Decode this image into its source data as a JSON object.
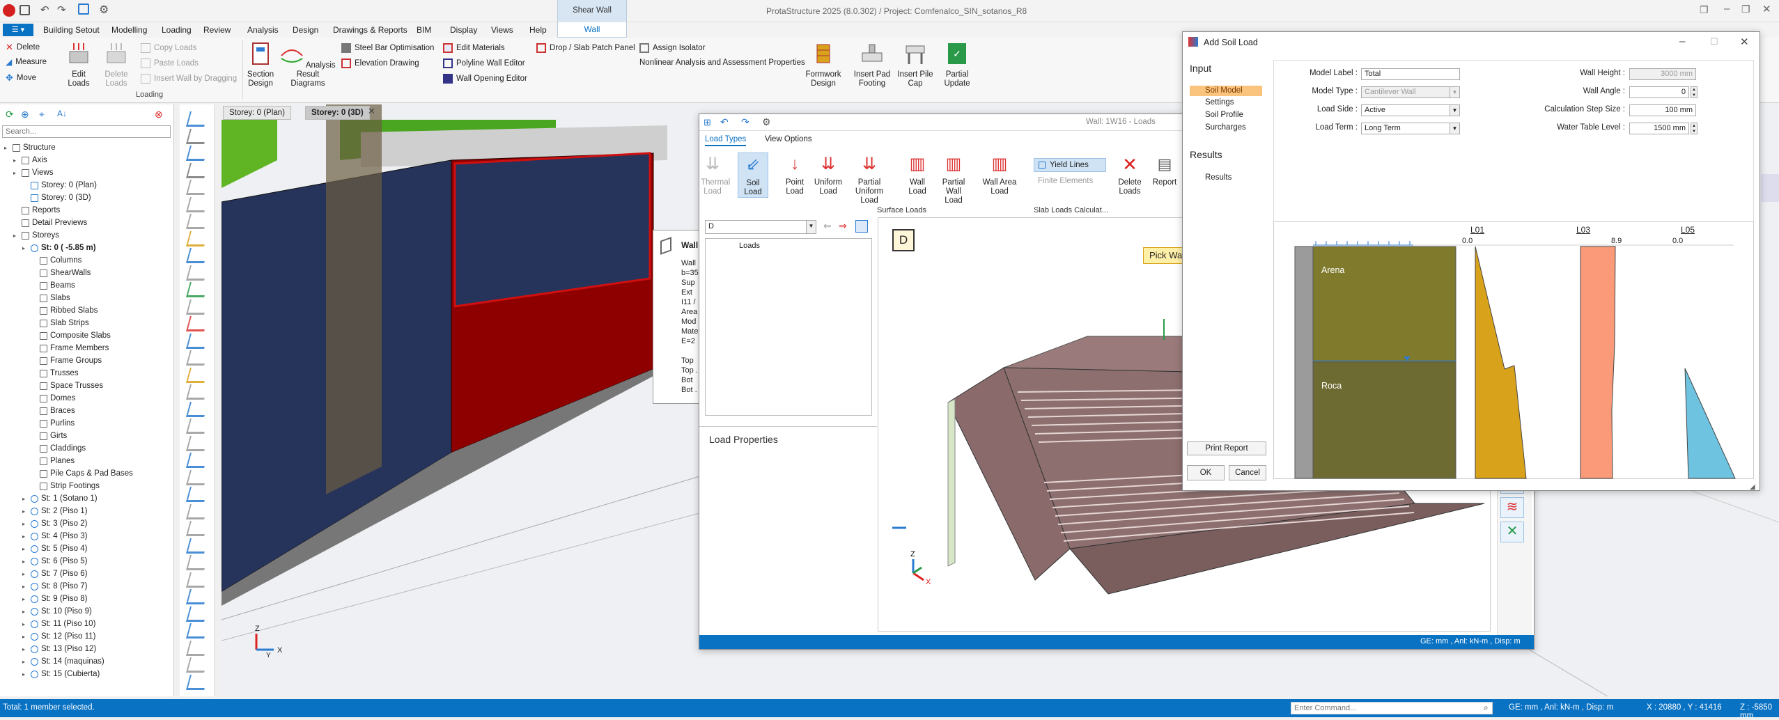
{
  "window": {
    "title": "ProtaStructure 2025 (8.0.302) / Project: Comfenalco_SIN_sotanos_R8",
    "context_tab_group": "Shear Wall Options",
    "context_tab": "Wall"
  },
  "menu": [
    "Building Setout",
    "Modelling",
    "Loading",
    "Review",
    "Analysis",
    "Design",
    "Drawings & Reports",
    "BIM",
    "Display",
    "Views",
    "Help"
  ],
  "ribbon": {
    "edit": {
      "delete": "Delete",
      "measure": "Measure",
      "move": "Move"
    },
    "edit_loads": "Edit Loads",
    "delete_loads": "Delete Loads",
    "copy_loads": "Copy Loads",
    "paste_loads": "Paste Loads",
    "insert_wall_by_dragging": "Insert Wall by Dragging",
    "group_label": "Loading",
    "section_design": "Section Design",
    "analysis_result_diagrams": "Analysis Result Diagrams",
    "steel_bar_optimisation": "Steel Bar Optimisation",
    "elevation_drawing": "Elevation Drawing",
    "edit_materials": "Edit Materials",
    "polyline_wall_editor": "Polyline Wall Editor",
    "wall_opening_editor": "Wall Opening Editor",
    "drop_slab_patch_panel": "Drop / Slab Patch Panel",
    "assign_isolator": "Assign Isolator",
    "nonlinear": "Nonlinear Analysis and Assessment Properties",
    "formwork_design": "Formwork Design",
    "insert_pad_footing": "Insert Pad Footing",
    "insert_pile_cap": "Insert Pile Cap",
    "partial_update": "Partial Update"
  },
  "left_panel": {
    "search_placeholder": "Search...",
    "tree": [
      {
        "label": "Structure",
        "level": 0
      },
      {
        "label": "Axis",
        "level": 1
      },
      {
        "label": "Views",
        "level": 1
      },
      {
        "label": "Storey: 0 (Plan)",
        "level": 2
      },
      {
        "label": "Storey: 0 (3D)",
        "level": 2
      },
      {
        "label": "Reports",
        "level": 1
      },
      {
        "label": "Detail Previews",
        "level": 1
      },
      {
        "label": "Storeys",
        "level": 1
      },
      {
        "label": "St: 0 ( -5.85 m)",
        "level": 2,
        "bold": true
      },
      {
        "label": "Columns",
        "level": 3
      },
      {
        "label": "ShearWalls",
        "level": 3
      },
      {
        "label": "Beams",
        "level": 3
      },
      {
        "label": "Slabs",
        "level": 3
      },
      {
        "label": "Ribbed Slabs",
        "level": 3
      },
      {
        "label": "Slab Strips",
        "level": 3
      },
      {
        "label": "Composite Slabs",
        "level": 3
      },
      {
        "label": "Frame Members",
        "level": 3
      },
      {
        "label": "Frame Groups",
        "level": 3
      },
      {
        "label": "Trusses",
        "level": 3
      },
      {
        "label": "Space Trusses",
        "level": 3
      },
      {
        "label": "Domes",
        "level": 3
      },
      {
        "label": "Braces",
        "level": 3
      },
      {
        "label": "Purlins",
        "level": 3
      },
      {
        "label": "Girts",
        "level": 3
      },
      {
        "label": "Claddings",
        "level": 3
      },
      {
        "label": "Planes",
        "level": 3
      },
      {
        "label": "Pile Caps & Pad Bases",
        "level": 3
      },
      {
        "label": "Strip Footings",
        "level": 3
      },
      {
        "label": "St: 1 (Sotano 1)",
        "level": 2
      },
      {
        "label": "St: 2 (Piso 1)",
        "level": 2
      },
      {
        "label": "St: 3 (Piso 2)",
        "level": 2
      },
      {
        "label": "St: 4 (Piso 3)",
        "level": 2
      },
      {
        "label": "St: 5 (Piso 4)",
        "level": 2
      },
      {
        "label": "St: 6 (Piso 5)",
        "level": 2
      },
      {
        "label": "St: 7 (Piso 6)",
        "level": 2
      },
      {
        "label": "St: 8 (Piso 7)",
        "level": 2
      },
      {
        "label": "St: 9 (Piso 8)",
        "level": 2
      },
      {
        "label": "St: 10 (Piso 9)",
        "level": 2
      },
      {
        "label": "St: 11 (Piso 10)",
        "level": 2
      },
      {
        "label": "St: 12 (Piso 11)",
        "level": 2
      },
      {
        "label": "St: 13 (Piso 12)",
        "level": 2
      },
      {
        "label": "St: 14 (maquinas)",
        "level": 2
      },
      {
        "label": "St: 15 (Cubierta)",
        "level": 2
      }
    ]
  },
  "view_tabs": [
    "Storey: 0 (Plan)",
    "Storey: 0 (3D)"
  ],
  "wall_popup": {
    "title": "Wall",
    "lines": [
      "Wall",
      "b=35",
      "Sup",
      "Ext",
      "I11 /",
      "Area",
      "Mod",
      "Mate",
      "E=2",
      "",
      "Top",
      "Top .",
      "Bot",
      "Bot ."
    ]
  },
  "loads_dialog": {
    "title": "Wall: 1W16 - Loads",
    "tabs": [
      "Load Types",
      "View Options"
    ],
    "buttons": [
      {
        "label": "Thermal Load",
        "disabled": true
      },
      {
        "label": "Soil Load",
        "active": true
      },
      {
        "label": "Point Load"
      },
      {
        "label": "Uniform Load"
      },
      {
        "label": "Partial Uniform Load"
      },
      {
        "label": "Wall Load"
      },
      {
        "label": "Partial Wall Load"
      },
      {
        "label": "Wall Area Load"
      }
    ],
    "yield_lines": "Yield Lines",
    "finite_elements": "Finite Elements",
    "delete_loads": "Delete Loads",
    "report": "Report",
    "group_surface": "Surface Loads",
    "group_slab": "Slab Loads Calculat...",
    "combo_value": "D",
    "loads_column": "Loads",
    "load_properties": "Load Properties",
    "d_badge": "D",
    "pick_wall": "Pick Wal",
    "status": "GE: mm , Anl: kN-m , Disp: m"
  },
  "soil_dialog": {
    "title": "Add Soil Load",
    "nav_input": "Input",
    "nav_items": [
      "Soil Model",
      "Settings",
      "Soil Profile",
      "Surcharges"
    ],
    "nav_results": "Results",
    "nav_results_item": "Results",
    "print_report": "Print Report",
    "ok": "OK",
    "cancel": "Cancel",
    "fields_left": [
      {
        "label": "Model Label :",
        "value": "Total",
        "type": "text"
      },
      {
        "label": "Model Type :",
        "value": "Cantilever Wall",
        "type": "select",
        "disabled": true
      },
      {
        "label": "Load Side :",
        "value": "Active",
        "type": "select"
      },
      {
        "label": "Load Term :",
        "value": "Long Term",
        "type": "select"
      }
    ],
    "fields_right": [
      {
        "label": "Wall Height :",
        "value": "3000 mm",
        "disabled": true
      },
      {
        "label": "Wall Angle :",
        "value": "0",
        "spin": true
      },
      {
        "label": "Calculation Step Size :",
        "value": "100 mm"
      },
      {
        "label": "Water Table Level :",
        "value": "1500 mm",
        "spin": true
      }
    ],
    "layers": [
      {
        "name": "Arena",
        "color": "#7f7a2c"
      },
      {
        "name": "Roca",
        "color": "#6e6b32"
      }
    ],
    "diagram_titles": [
      "L01",
      "L03",
      "L05"
    ],
    "diagram_values": [
      "0.0",
      "8.9",
      "0.0"
    ],
    "diagram_colors": [
      "#d9a21b",
      "#fa9a78",
      "#6ec3e0"
    ]
  },
  "status": {
    "left": "Total: 1 member selected.",
    "command_placeholder": "Enter Command...",
    "units": "GE: mm , Anl: kN-m , Disp: m",
    "coords": "X : 20880 , Y : 41416",
    "z": "Z : -5850 mm"
  }
}
